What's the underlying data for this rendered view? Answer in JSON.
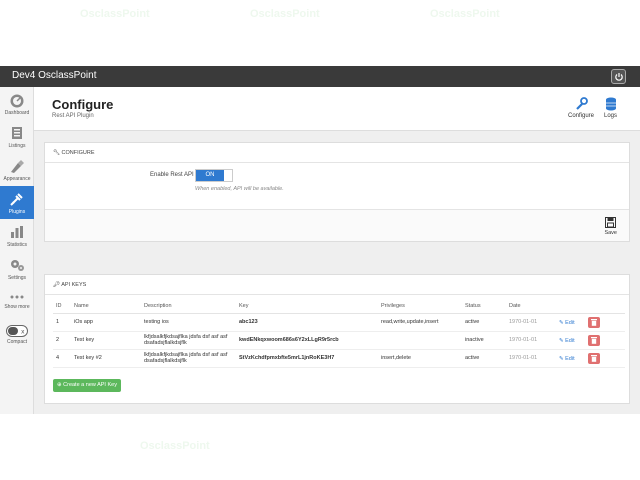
{
  "topbar": {
    "title": "Dev4 OsclassPoint"
  },
  "sidebar": {
    "items": [
      {
        "label": "Dashboard",
        "icon": "dashboard-icon"
      },
      {
        "label": "Listings",
        "icon": "listings-icon"
      },
      {
        "label": "Appearance",
        "icon": "appearance-icon"
      },
      {
        "label": "Plugins",
        "icon": "plugins-icon",
        "active": true
      },
      {
        "label": "Statistics",
        "icon": "statistics-icon"
      },
      {
        "label": "Settings",
        "icon": "settings-icon"
      },
      {
        "label": "Show more",
        "icon": "more-icon"
      },
      {
        "label": "Compact",
        "icon": "compact-toggle-icon"
      }
    ]
  },
  "header": {
    "title": "Configure",
    "subtitle": "Rest API Plugin",
    "configure_label": "Configure",
    "logs_label": "Logs"
  },
  "configure_panel": {
    "heading": "CONFIGURE",
    "enable_label": "Enable Rest API",
    "toggle_value": "ON",
    "hint": "When enabled, API will be available.",
    "save_label": "Save"
  },
  "keys_panel": {
    "heading": "API KEYS",
    "columns": {
      "id": "ID",
      "name": "Name",
      "description": "Description",
      "key": "Key",
      "privileges": "Privileges",
      "status": "Status",
      "date": "Date"
    },
    "rows": [
      {
        "id": "1",
        "name": "iOs app",
        "description_1": "testing ios",
        "description_2": "",
        "key": "abc123",
        "privileges": "read,write,update,insert",
        "status": "active",
        "date": "1970-01-01"
      },
      {
        "id": "2",
        "name": "Test key",
        "description_1": "lkfjdsalkfjkdsajflka jdsfa dsf asf asf",
        "description_2": "dsafadsjflalkdsjflk",
        "key": "kwdENkqxwoom686s6Y2xLLgR9r5rcb",
        "privileges": "",
        "status": "inactive",
        "date": "1970-01-01"
      },
      {
        "id": "4",
        "name": "Test key #2",
        "description_1": "lkfjdsalkfjkdsajflka jdsfa dsf asf asf",
        "description_2": "dsafadsjflalkdsjflk",
        "key": "StVzKchdfpmxbfte5mrL1jnRoKE3H7",
        "privileges": "insert,delete",
        "status": "active",
        "date": "1970-01-01"
      }
    ],
    "edit_label": "Edit",
    "create_label": "Create a new API Key"
  },
  "watermark_text": "OsclassPoint",
  "colors": {
    "accent": "#2f7ad0",
    "danger": "#e07070",
    "success": "#5cb85c",
    "topbar": "#3a3a3a"
  }
}
